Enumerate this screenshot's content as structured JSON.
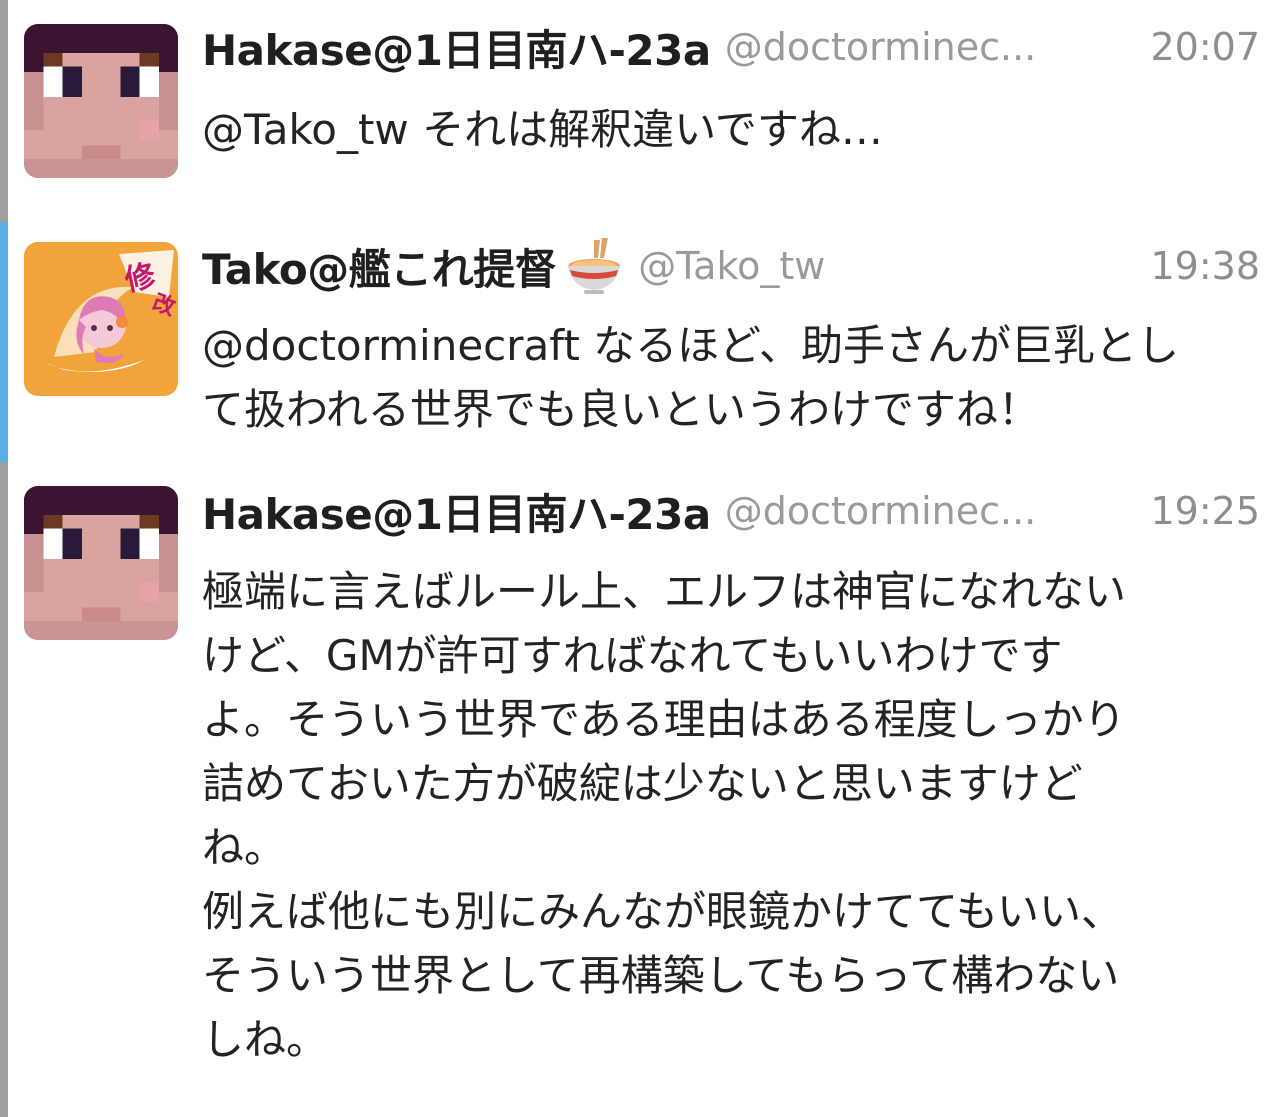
{
  "tweets": [
    {
      "avatar": "pixel-character-avatar",
      "display_name": "Hakase@1日目南ハ-23a",
      "handle": "@doctorminec...",
      "time": "20:07",
      "text": "@Tako_tw それは解釈違いですね…"
    },
    {
      "avatar": "anime-character-avatar",
      "display_name": "Tako@艦これ提督",
      "name_emoji": "ramen-bowl-icon",
      "handle": "@Tako_tw",
      "time": "19:38",
      "text": "@doctorminecraft なるほど、助手さんが巨乳とし\nて扱われる世界でも良いというわけですね！"
    },
    {
      "avatar": "pixel-character-avatar",
      "display_name": "Hakase@1日目南ハ-23a",
      "handle": "@doctorminec...",
      "time": "19:25",
      "text": "極端に言えばルール上、エルフは神官になれない\nけど、GMが許可すればなれてもいいわけです\nよ。そういう世界である理由はある程度しっかり\n詰めておいた方が破綻は少ないと思いますけど\nね。\n例えば他にも別にみんなが眼鏡かけててもいい、\nそういう世界として再構築してもらって構わない\nしね。"
    }
  ],
  "colors": {
    "unread_indicator": "#5aaee8",
    "read_indicator": "#9f9f9f",
    "avatar_bg_orange": "#f2a33a"
  }
}
